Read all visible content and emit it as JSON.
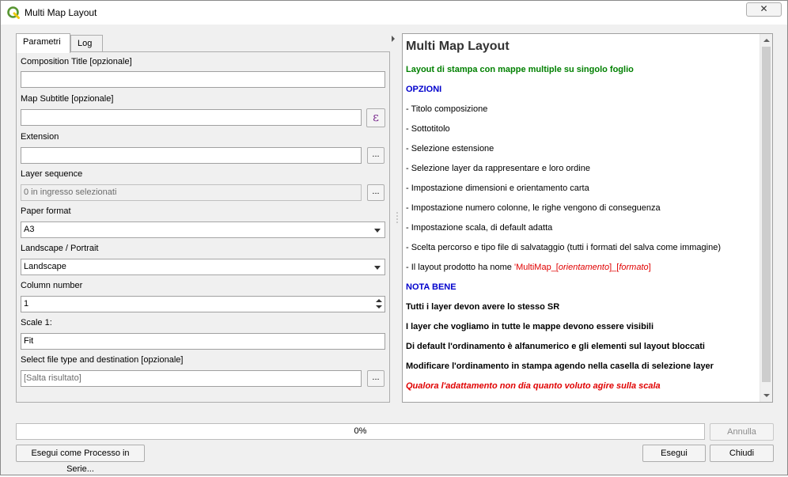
{
  "window": {
    "title": "Multi Map Layout",
    "close_label": "✕"
  },
  "tabs": [
    {
      "label": "Parametri",
      "active": true
    },
    {
      "label": "Log",
      "active": false
    }
  ],
  "params": {
    "composition_title_label": "Composition Title [opzionale]",
    "composition_title_value": "",
    "map_subtitle_label": "Map Subtitle [opzionale]",
    "map_subtitle_value": "",
    "expression_glyph": "ε",
    "extension_label": "Extension",
    "extension_value": "",
    "layer_sequence_label": "Layer sequence",
    "layer_sequence_value": "0 in ingresso selezionati",
    "paper_format_label": "Paper format",
    "paper_format_value": "A3",
    "orientation_label": "Landscape / Portrait",
    "orientation_value": "Landscape",
    "column_number_label": "Column number",
    "column_number_value": "1",
    "scale_label": "Scale 1:",
    "scale_value": "Fit",
    "output_label": "Select file type and destination [opzionale]",
    "output_value": "[Salta risultato]",
    "browse_label": "..."
  },
  "help": {
    "title": "Multi Map Layout",
    "subtitle": "Layout di stampa con mappe multiple su singolo foglio",
    "options_heading": "OPZIONI",
    "options": [
      "- Titolo composizione",
      "- Sottotitolo",
      "- Selezione estensione",
      "- Selezione layer da rappresentare e loro ordine",
      "- Impostazione dimensioni e orientamento carta",
      "- Impostazione numero colonne, le righe vengono di conseguenza",
      "- Impostazione scala, di default adatta",
      "- Scelta percorso e tipo file di salvataggio (tutti i formati del salva come immagine)"
    ],
    "layout_name_prefix": "- Il layout prodotto ha nome ",
    "layout_name_part1": "'MultiMap_[",
    "layout_name_part2": "orientamento",
    "layout_name_part3": "]_[",
    "layout_name_part4": "formato",
    "layout_name_part5": "]",
    "nota_heading": "NOTA BENE",
    "notes": [
      "Tutti i layer devon avere lo stesso SR",
      "I layer che vogliamo in tutte le mappe devono essere visibili",
      "Di default l'ordinamento è alfanumerico e gli elementi sul layout bloccati",
      "Modificare l'ordinamento in stampa agendo nella casella di selezione layer"
    ],
    "warning": "Qualora l'adattamento non dia quanto voluto agire sulla scala"
  },
  "progress": {
    "value": 0,
    "text": "0%"
  },
  "buttons": {
    "annulla": "Annulla",
    "batch": "Esegui come Processo in Serie...",
    "esegui": "Esegui",
    "chiudi": "Chiudi"
  },
  "colors": {
    "green": "#008000",
    "blue": "#0000cc",
    "red": "#e00000",
    "qgis_green": "#589632",
    "qgis_yellow": "#eec90d"
  }
}
